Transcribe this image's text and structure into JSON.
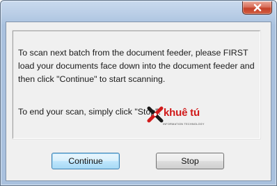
{
  "window": {
    "title": "",
    "close_icon": "close-icon",
    "accent_color": "#c4412a"
  },
  "message": {
    "line1": "To scan next batch from the document feeder, please FIRST load your documents face down into the document feeder and then click \"Continue\" to start scanning.",
    "line2": "To end your scan, simply click \"Stop\"."
  },
  "logo": {
    "name": "khuê tú",
    "tagline": "INFORMATION TECHNOLOGY",
    "brand_color": "#d11a1a"
  },
  "buttons": {
    "continue_label": "Continue",
    "stop_label": "Stop"
  }
}
